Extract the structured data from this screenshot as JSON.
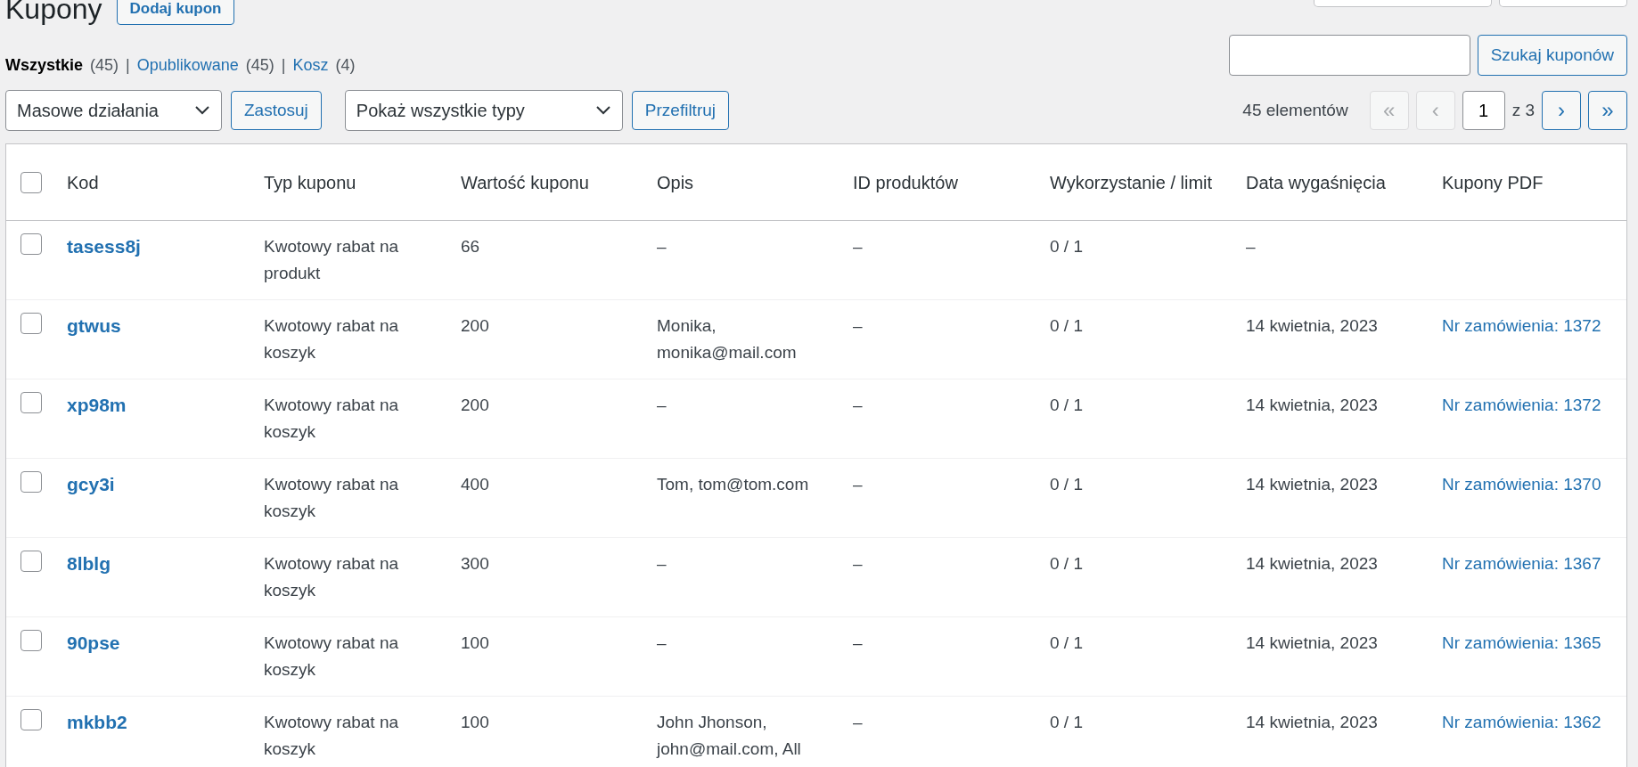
{
  "page_title": "Kupony",
  "add_button": "Dodaj kupon",
  "header_tabs": [
    {
      "kind": "tab"
    },
    {
      "kind": "tab"
    }
  ],
  "status_links": [
    {
      "label": "Wszystkie",
      "count": "(45)",
      "selected": true
    },
    {
      "separator": "|",
      "label": "Opublikowane",
      "count": "(45)",
      "selected": false
    },
    {
      "separator": "|",
      "label": "Kosz",
      "count": "(4)",
      "selected": false
    }
  ],
  "search": {
    "button": "Szukaj kuponów"
  },
  "bulk_actions": {
    "value": "Masowe działania",
    "apply": "Zastosuj"
  },
  "type_filter": {
    "value": "Pokaż wszystkie typy",
    "apply": "Przefiltruj"
  },
  "pagination": {
    "count": "45 elementów",
    "buttons": [
      {
        "label": "«",
        "disabled": true
      },
      {
        "label": "‹",
        "disabled": true
      }
    ],
    "page": "1",
    "of": "z 3",
    "next_buttons": [
      {
        "label": "›",
        "disabled": false
      },
      {
        "label": "»",
        "disabled": false
      }
    ]
  },
  "table": {
    "select_all_checked": false,
    "columns": [
      "Kod",
      "Typ kuponu",
      "Wartość kuponu",
      "Opis",
      "ID produktów",
      "Wykorzystanie / limit",
      "Data wygaśnięcia",
      "Kupony PDF"
    ],
    "rows": [
      {
        "checked": false,
        "code": "tasess8j",
        "type": "Kwotowy rabat na produkt",
        "value": "66",
        "description": "–",
        "product_ids": "–",
        "usage": "0 / 1",
        "expiry": "–"
      },
      {
        "checked": false,
        "code": "gtwus",
        "type": "Kwotowy rabat na koszyk",
        "value": "200",
        "description": "Monika, monika@mail.com",
        "product_ids": "–",
        "usage": "0 / 1",
        "expiry": "14 kwietnia, 2023",
        "pdf": "Nr zamówienia: 1372"
      },
      {
        "checked": false,
        "code": "xp98m",
        "type": "Kwotowy rabat na koszyk",
        "value": "200",
        "description": "–",
        "product_ids": "–",
        "usage": "0 / 1",
        "expiry": "14 kwietnia, 2023",
        "pdf": "Nr zamówienia: 1372"
      },
      {
        "checked": false,
        "code": "gcy3i",
        "type": "Kwotowy rabat na koszyk",
        "value": "400",
        "description": "Tom, tom@tom.com",
        "product_ids": "–",
        "usage": "0 / 1",
        "expiry": "14 kwietnia, 2023",
        "pdf": "Nr zamówienia: 1370"
      },
      {
        "checked": false,
        "code": "8lblg",
        "type": "Kwotowy rabat na koszyk",
        "value": "300",
        "description": "–",
        "product_ids": "–",
        "usage": "0 / 1",
        "expiry": "14 kwietnia, 2023",
        "pdf": "Nr zamówienia: 1367"
      },
      {
        "checked": false,
        "code": "90pse",
        "type": "Kwotowy rabat na koszyk",
        "value": "100",
        "description": "–",
        "product_ids": "–",
        "usage": "0 / 1",
        "expiry": "14 kwietnia, 2023",
        "pdf": "Nr zamówienia: 1365"
      },
      {
        "checked": false,
        "code": "mkbb2",
        "type": "Kwotowy rabat na koszyk",
        "value": "100",
        "description": "John Jhonson, john@mail.com, All",
        "product_ids": "–",
        "usage": "0 / 1",
        "expiry": "14 kwietnia, 2023",
        "pdf": "Nr zamówienia: 1362"
      }
    ]
  }
}
